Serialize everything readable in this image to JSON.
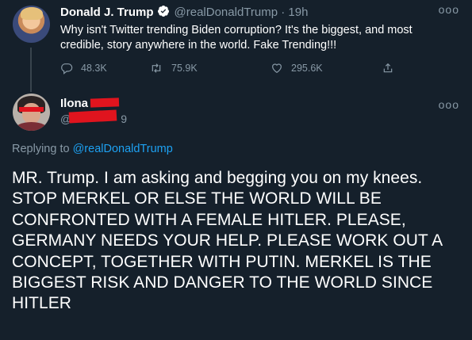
{
  "original_tweet": {
    "display_name": "Donald J. Trump",
    "handle": "@realDonaldTrump",
    "time": "· 19h",
    "text": "Why isn't Twitter trending Biden corruption? It's the biggest, and most credible, story anywhere in the world. Fake Trending!!!",
    "replies": "48.3K",
    "retweets": "75.9K",
    "likes": "295.6K",
    "more": "ooo"
  },
  "reply": {
    "display_name": "Ilona",
    "handle_suffix": "9",
    "more": "ooo",
    "replying_prefix": "Replying to ",
    "replying_to": "@realDonaldTrump",
    "text": "MR.  Trump.  I am asking and begging you on my knees.  STOP MERKEL  OR ELSE THE WORLD WILL BE CONFRONTED WITH A FEMALE HITLER.  PLEASE, GERMANY NEEDS YOUR HELP.  PLEASE WORK OUT A CONCEPT,  TOGETHER WITH PUTIN.  MERKEL IS THE BIGGEST RISK AND DANGER TO THE WORLD SINCE HITLER"
  },
  "colors": {
    "background": "#15202b",
    "secondary_text": "#8899a6",
    "link": "#1da1f2",
    "redaction": "#e0141e"
  },
  "icons": [
    "verified-badge-icon",
    "reply-icon",
    "retweet-icon",
    "like-icon",
    "share-icon",
    "more-icon"
  ]
}
